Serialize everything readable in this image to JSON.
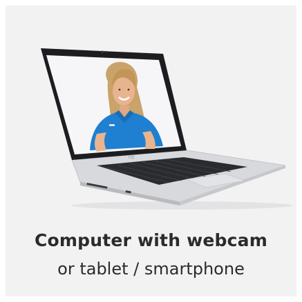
{
  "card": {
    "title": "Computer with webcam",
    "subtitle": "or tablet / smartphone"
  },
  "illustration": {
    "icon": "laptop-with-video-call-icon",
    "colors": {
      "background": "#f2f2f3",
      "laptop_body": "#d9dadd",
      "screen_bezel": "#1c1d20",
      "screen_bg": "#f6f6f8",
      "shirt": "#1f7fd0",
      "hair": "#c9a36a",
      "skin": "#e8b48f"
    }
  }
}
